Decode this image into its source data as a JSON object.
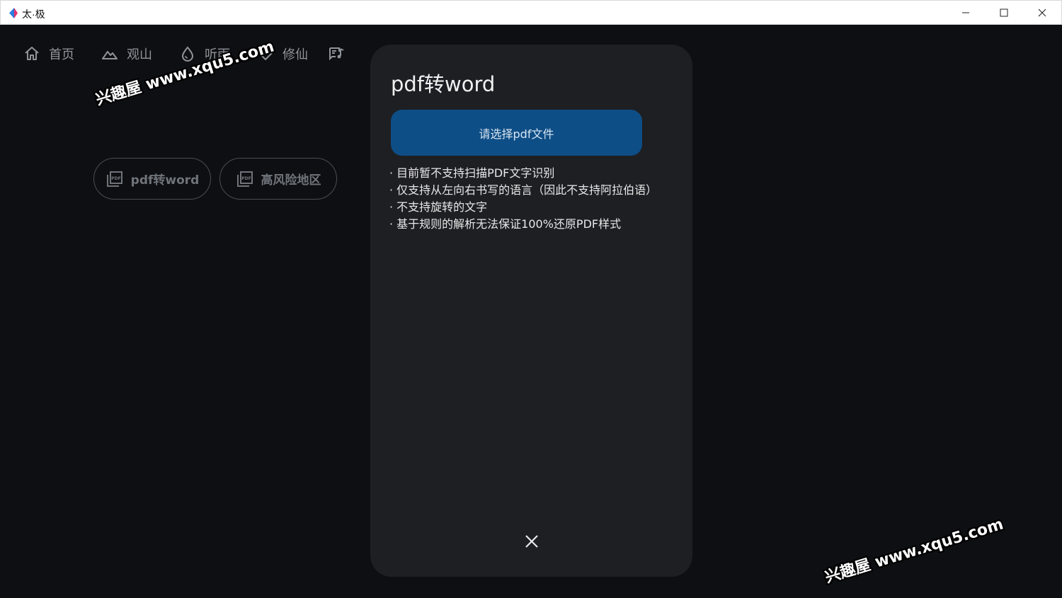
{
  "window": {
    "title": "太·极",
    "controls": {
      "minimize": "minimize-icon",
      "maximize": "maximize-icon",
      "close": "close-icon"
    }
  },
  "nav": {
    "items": [
      {
        "label": "首页",
        "icon": "home-icon"
      },
      {
        "label": "观山",
        "icon": "mountain-icon"
      },
      {
        "label": "听雨",
        "icon": "water-drop-icon"
      },
      {
        "label": "修仙",
        "icon": "heart-icon"
      },
      {
        "label": "",
        "icon": "music-note-icon"
      }
    ]
  },
  "tools": [
    {
      "label": "pdf转word",
      "icon": "pdf-icon"
    },
    {
      "label": "高风险地区",
      "icon": "pdf-icon"
    }
  ],
  "dialog": {
    "title": "pdf转word",
    "select_button": "请选择pdf文件",
    "notes": [
      "目前暂不支持扫描PDF文字识别",
      "仅支持从左向右书写的语言（因此不支持阿拉伯语）",
      "不支持旋转的文字",
      "基于规则的解析无法保证100%还原PDF样式"
    ],
    "close_icon": "close-icon"
  },
  "watermark": {
    "text": "兴趣屋 www.xqu5.com"
  },
  "colors": {
    "background": "#0e0f12",
    "dialog": "#1e1f23",
    "accent": "#0e4e86",
    "nav_text": "#8f949a"
  }
}
